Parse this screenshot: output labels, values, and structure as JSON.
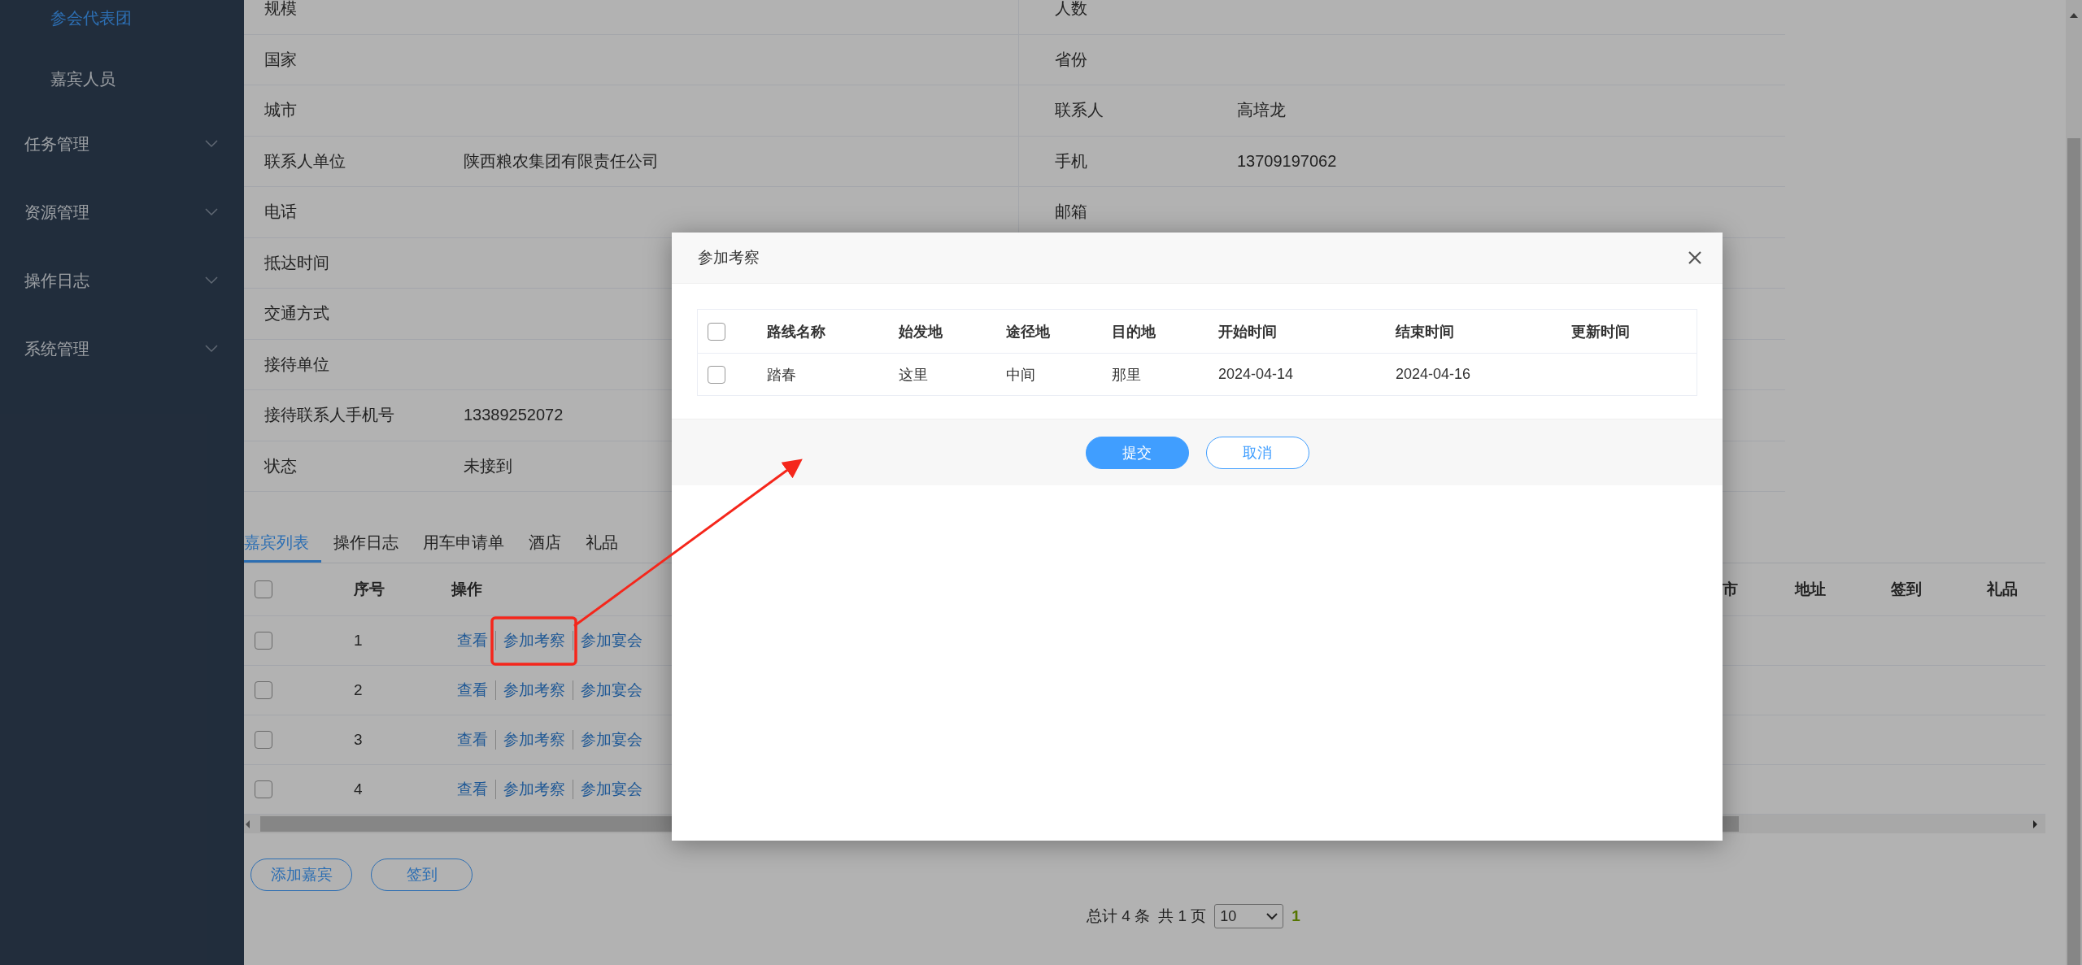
{
  "sidebar": {
    "items": [
      {
        "label": "参会代表团",
        "kind": "subitem",
        "selected": true
      },
      {
        "label": "嘉宾人员",
        "kind": "subitem",
        "selected": false
      },
      {
        "label": "任务管理",
        "kind": "group",
        "selected": false
      },
      {
        "label": "资源管理",
        "kind": "group",
        "selected": false
      },
      {
        "label": "操作日志",
        "kind": "group",
        "selected": false
      },
      {
        "label": "系统管理",
        "kind": "group",
        "selected": false
      }
    ]
  },
  "details": {
    "rows": [
      {
        "left": {
          "label": "规模"
        },
        "right": {
          "label": "人数"
        }
      },
      {
        "left": {
          "label": "国家"
        },
        "right": {
          "label": "省份"
        }
      },
      {
        "left": {
          "label": "城市"
        },
        "right": {
          "label": "联系人",
          "value": "高培龙"
        }
      },
      {
        "left": {
          "label": "联系人单位",
          "value": "陕西粮农集团有限责任公司"
        },
        "right": {
          "label": "手机",
          "value": "13709197062"
        }
      },
      {
        "left": {
          "label": "电话"
        },
        "right": {
          "label": "邮箱"
        }
      },
      {
        "left": {
          "label": "抵达时间"
        }
      },
      {
        "left": {
          "label": "交通方式"
        }
      },
      {
        "left": {
          "label": "接待单位"
        }
      },
      {
        "left": {
          "label": "接待联系人手机号",
          "value": "13389252072"
        }
      },
      {
        "left": {
          "label": "状态",
          "value": "未接到"
        }
      }
    ]
  },
  "tabs": [
    {
      "label": "嘉宾列表",
      "selected": true
    },
    {
      "label": "操作日志",
      "selected": false
    },
    {
      "label": "用车申请单",
      "selected": false
    },
    {
      "label": "酒店",
      "selected": false
    },
    {
      "label": "礼品",
      "selected": false
    }
  ],
  "guest_table": {
    "all_checked": false,
    "columns_left": [
      "序号",
      "操作"
    ],
    "columns_right": [
      "市",
      "地址",
      "签到",
      "礼品"
    ],
    "rows": [
      {
        "checked": false,
        "index": "1",
        "actions": [
          "查看",
          "参加考察",
          "参加宴会"
        ]
      },
      {
        "checked": false,
        "index": "2",
        "actions": [
          "查看",
          "参加考察",
          "参加宴会"
        ]
      },
      {
        "checked": false,
        "index": "3",
        "actions": [
          "查看",
          "参加考察",
          "参加宴会"
        ]
      },
      {
        "checked": false,
        "index": "4",
        "actions": [
          "查看",
          "参加考察",
          "参加宴会"
        ]
      }
    ]
  },
  "buttons": [
    "添加嘉宾",
    "签到"
  ],
  "pagination": {
    "total": "总计 4 条",
    "pages": "共 1 页",
    "page_size": "10",
    "current_page": "1"
  },
  "dialog": {
    "title": "参加考察",
    "all_checked": false,
    "columns": [
      "路线名称",
      "始发地",
      "途径地",
      "目的地",
      "开始时间",
      "结束时间",
      "更新时间"
    ],
    "rows": [
      {
        "checked": false,
        "cells": [
          "踏春",
          "这里",
          "中间",
          "那里",
          "2024-04-14",
          "2024-04-16"
        ]
      }
    ],
    "buttons": [
      {
        "label": "提交",
        "kind": "primary"
      },
      {
        "label": "取消",
        "kind": "default"
      }
    ]
  }
}
